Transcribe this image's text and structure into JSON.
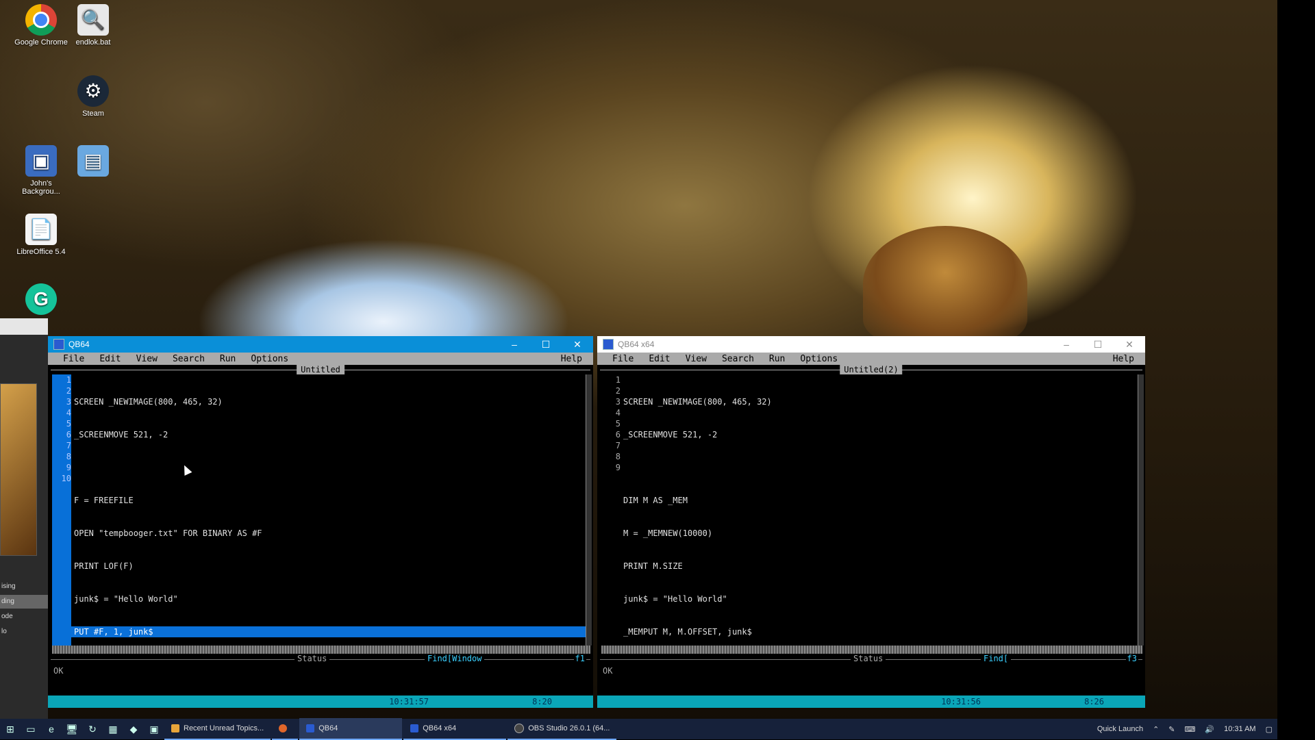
{
  "desktop": {
    "icons": [
      {
        "label": "Google Chrome",
        "icon": "chrome-icon"
      },
      {
        "label": "endlok.bat",
        "icon": "file-icon"
      },
      {
        "label": "Steam",
        "icon": "steam-icon"
      },
      {
        "label": "John's Backgrou...",
        "icon": "app-icon"
      },
      {
        "label": "",
        "icon": "folder-icon"
      },
      {
        "label": "LibreOffice 5.4",
        "icon": "document-icon"
      },
      {
        "label": "",
        "icon": "grammarly-icon"
      }
    ],
    "left_panel_items": [
      "ising",
      "ding",
      "ode",
      "lo"
    ]
  },
  "windows": [
    {
      "title": "QB64",
      "state": "active",
      "menu": [
        "File",
        "Edit",
        "View",
        "Search",
        "Run",
        "Options"
      ],
      "help": "Help",
      "doc_title": "Untitled",
      "line_numbers": [
        "1",
        "2",
        "3",
        "4",
        "5",
        "6",
        "7",
        "8",
        "9",
        "10"
      ],
      "code": [
        "SCREEN _NEWIMAGE(800, 465, 32)",
        "_SCREENMOVE 521, -2",
        "",
        "F = FREEFILE",
        "OPEN \"tempbooger.txt\" FOR BINARY AS #F",
        "PRINT LOF(F)",
        "junk$ = \"Hello World\"",
        "PUT #F, 1, junk$",
        "",
        ""
      ],
      "selected_line": 8,
      "status_label": "Status",
      "find_label": "Find[Window",
      "find_num": "f1",
      "status_text": "OK",
      "time": "10:31:57",
      "position": "8:20"
    },
    {
      "title": "QB64 x64",
      "state": "inactive",
      "menu": [
        "File",
        "Edit",
        "View",
        "Search",
        "Run",
        "Options"
      ],
      "help": "Help",
      "doc_title": "Untitled(2)",
      "line_numbers": [
        "1",
        "2",
        "3",
        "4",
        "5",
        "6",
        "7",
        "8",
        "9"
      ],
      "code": [
        "SCREEN _NEWIMAGE(800, 465, 32)",
        "_SCREENMOVE 521, -2",
        "",
        "DIM M AS _MEM",
        "M = _MEMNEW(10000)",
        "PRINT M.SIZE",
        "junk$ = \"Hello World\"",
        "_MEMPUT M, M.OFFSET, junk$",
        ""
      ],
      "status_label": "Status",
      "find_label": "Find[",
      "find_num": "f3",
      "status_text": "OK",
      "time": "10:31:56",
      "position": "8:26"
    }
  ],
  "taskbar": {
    "apps": [
      {
        "label": "Recent Unread Topics...",
        "color": "#e8a53a"
      },
      {
        "label": "",
        "color": "#e0662a"
      },
      {
        "label": "QB64",
        "color": "#2a5bd0",
        "active": true
      },
      {
        "label": "QB64 x64",
        "color": "#2a5bd0"
      },
      {
        "label": "OBS Studio 26.0.1 (64...",
        "color": "#444"
      }
    ],
    "quick_launch": "Quick Launch",
    "clock": "10:31 AM"
  },
  "colors": {
    "title_active": "#0a8fd8",
    "selection": "#0a70d8",
    "status_bar": "#0aa6b8",
    "taskbar": "#16213a"
  }
}
